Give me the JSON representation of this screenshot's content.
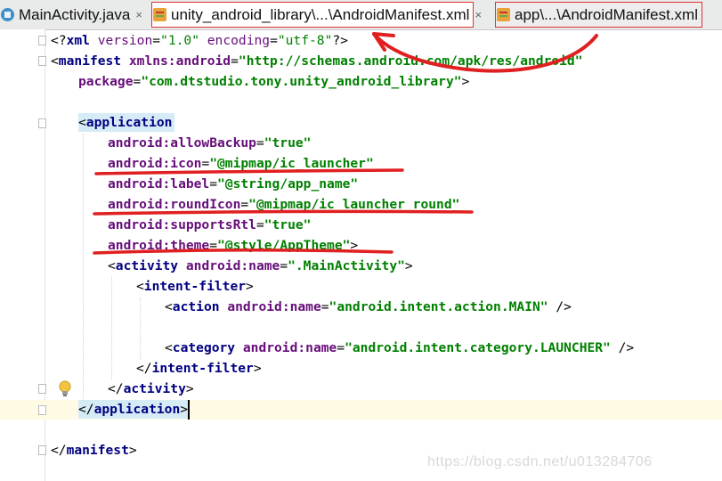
{
  "tabs": [
    {
      "label": "MainActivity.java",
      "active": false,
      "close": "×",
      "icon": "java-class-icon"
    },
    {
      "label": "unity_android_library\\...\\AndroidManifest.xml",
      "active": true,
      "close": "×",
      "icon": "xml-manifest-icon"
    },
    {
      "label": "app\\...\\AndroidManifest.xml",
      "active": false,
      "close": "",
      "icon": "xml-manifest-icon"
    }
  ],
  "code": {
    "l1": {
      "a": "<?",
      "b": "xml ",
      "c": "version",
      "d": "=",
      "e": "\"1.0\"",
      "f": " encoding",
      "g": "=",
      "h": "\"utf-8\"",
      "i": "?>"
    },
    "l2": {
      "a": "<",
      "b": "manifest ",
      "c": "xmlns:android",
      "d": "=",
      "e": "\"http://schemas.android.com/apk/res/android\""
    },
    "l3": {
      "a": "package",
      "b": "=",
      "c": "\"com.dtstudio.tony.unity_android_library\"",
      "d": ">"
    },
    "l4": {
      "a": "<",
      "b": "application"
    },
    "l5": {
      "a": "android:allowBackup",
      "b": "=",
      "c": "\"true\""
    },
    "l6": {
      "a": "android:icon",
      "b": "=",
      "c": "\"@mipmap/ic_launcher\""
    },
    "l7": {
      "a": "android:label",
      "b": "=",
      "c": "\"@string/app_name\""
    },
    "l8": {
      "a": "android:roundIcon",
      "b": "=",
      "c": "\"@mipmap/ic_launcher_round\""
    },
    "l9": {
      "a": "android:supportsRtl",
      "b": "=",
      "c": "\"true\""
    },
    "l10": {
      "a": "android:theme",
      "b": "=",
      "c": "\"@style/AppTheme\"",
      "d": ">"
    },
    "l11": {
      "a": "<",
      "b": "activity ",
      "c": "android:name",
      "d": "=",
      "e": "\".MainActivity\"",
      "f": ">"
    },
    "l12": {
      "a": "<",
      "b": "intent-filter",
      "c": ">"
    },
    "l13": {
      "a": "<",
      "b": "action ",
      "c": "android:name",
      "d": "=",
      "e": "\"android.intent.action.MAIN\"",
      "f": " />"
    },
    "l14": {
      "a": "<",
      "b": "category ",
      "c": "android:name",
      "d": "=",
      "e": "\"android.intent.category.LAUNCHER\"",
      "f": " />"
    },
    "l15": {
      "a": "</",
      "b": "intent-filter",
      "c": ">"
    },
    "l16": {
      "a": "</",
      "b": "activity",
      "c": ">"
    },
    "l17": {
      "a": "</",
      "b": "application",
      "c": ">"
    },
    "l18": {
      "a": "</",
      "b": "manifest",
      "c": ">"
    }
  },
  "watermark": "https://blog.csdn.net/u013284706",
  "colors": {
    "tag": "#000080",
    "attr": "#660e7a",
    "string": "#008000",
    "annotation": "#e02020",
    "tag_highlight": "#d5ecf6",
    "current_line": "#fffae3"
  }
}
